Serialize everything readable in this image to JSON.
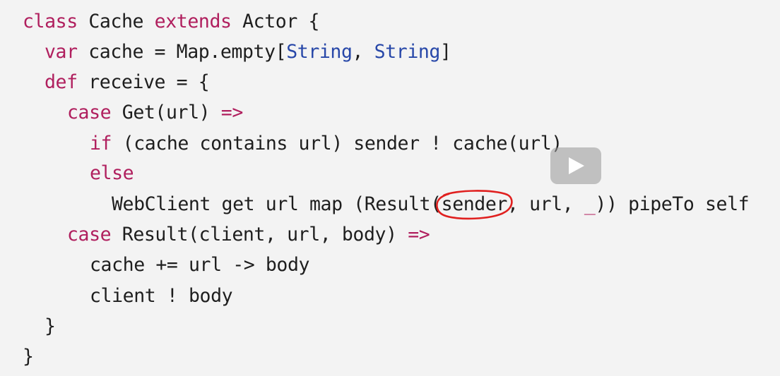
{
  "code": {
    "l1": {
      "kw1": "class",
      "p1": " Cache ",
      "kw2": "extends",
      "p2": " Actor {"
    },
    "l2": {
      "kw1": "var",
      "p1": " cache = Map.empty[",
      "t1": "String",
      "p2": ", ",
      "t2": "String",
      "p3": "]"
    },
    "l3": {
      "kw1": "def",
      "p1": " receive = {"
    },
    "l4": {
      "kw1": "case",
      "p1": " Get(url) ",
      "kw2": "=>"
    },
    "l5": {
      "kw1": "if",
      "p1": " (cache contains url) sender ! cache(url)"
    },
    "l6": {
      "kw1": "else"
    },
    "l7": {
      "p1": "WebClient get url map (Result(",
      "p2": "sender",
      "p3": ", url, ",
      "p4": "_",
      "p5": ")) pipeTo self"
    },
    "l8": {
      "kw1": "case",
      "p1": " Result(client, url, body) ",
      "kw2": "=>"
    },
    "l9": {
      "p1": "cache += url -> body"
    },
    "l10": {
      "p1": "client ! body"
    },
    "l11": {
      "p1": "}"
    },
    "l12": {
      "p1": "}"
    }
  },
  "colors": {
    "keyword": "#b01f5e",
    "type": "#2747a8",
    "annotation": "#e0201f",
    "background": "#f3f3f3"
  },
  "overlay": {
    "icon": "play-icon"
  }
}
